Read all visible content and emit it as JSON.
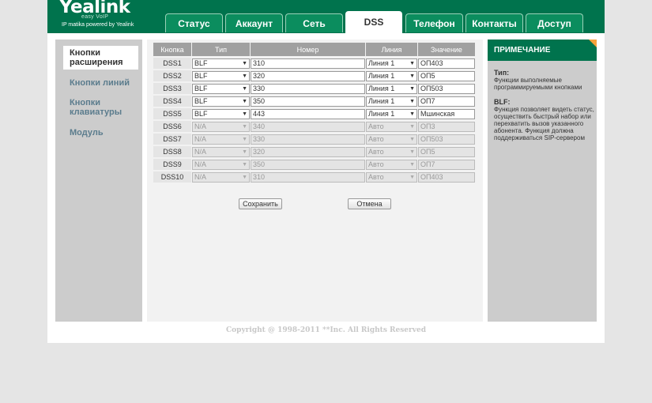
{
  "brand": {
    "logo": "Yealink",
    "sub": "easy VoIP",
    "tagline": "IP matika powered by Yealink"
  },
  "tabs": [
    "Статус",
    "Аккаунт",
    "Сеть",
    "DSS",
    "Телефон",
    "Контакты",
    "Доступ"
  ],
  "active_tab": "DSS",
  "sidebar": [
    "Кнопки расширения",
    "Кнопки линий",
    "Кнопки клавиатуры",
    "Модуль"
  ],
  "table": {
    "headers": [
      "Кнопка",
      "Тип",
      "Номер",
      "Линия",
      "Значение"
    ],
    "rows": [
      {
        "key": "DSS1",
        "type": "BLF",
        "number": "310",
        "line": "Линия 1",
        "value": "ОП403",
        "enabled": true
      },
      {
        "key": "DSS2",
        "type": "BLF",
        "number": "320",
        "line": "Линия 1",
        "value": "ОП5",
        "enabled": true
      },
      {
        "key": "DSS3",
        "type": "BLF",
        "number": "330",
        "line": "Линия 1",
        "value": "ОП503",
        "enabled": true
      },
      {
        "key": "DSS4",
        "type": "BLF",
        "number": "350",
        "line": "Линия 1",
        "value": "ОП7",
        "enabled": true
      },
      {
        "key": "DSS5",
        "type": "BLF",
        "number": "443",
        "line": "Линия 1",
        "value": "Мшинская",
        "enabled": true
      },
      {
        "key": "DSS6",
        "type": "N/A",
        "number": "340",
        "line": "Авто",
        "value": "ОП3",
        "enabled": false
      },
      {
        "key": "DSS7",
        "type": "N/A",
        "number": "330",
        "line": "Авто",
        "value": "ОП503",
        "enabled": false
      },
      {
        "key": "DSS8",
        "type": "N/A",
        "number": "320",
        "line": "Авто",
        "value": "ОП5",
        "enabled": false
      },
      {
        "key": "DSS9",
        "type": "N/A",
        "number": "350",
        "line": "Авто",
        "value": "ОП7",
        "enabled": false
      },
      {
        "key": "DSS10",
        "type": "N/A",
        "number": "310",
        "line": "Авто",
        "value": "ОП403",
        "enabled": false
      }
    ]
  },
  "buttons": {
    "save": "Сохранить",
    "cancel": "Отмена"
  },
  "note": {
    "title": "ПРИМЕЧАНИЕ",
    "type_label": "Тип:",
    "type_text": "Функции выполняемые программируемыми кнопками",
    "blf_label": "BLF:",
    "blf_text": "Функция позволяет видеть статус, осуществить быстрый набор или перехватить вызов указанного абонента. Функция должна поддерживаться SIP-сервером"
  },
  "footer": "Copyright @ 1998-2011 **Inc. All Rights Reserved",
  "colors": {
    "header": "#00734d",
    "tab": "#0b8d5e",
    "accent": "#f6a23c",
    "sidebar_link": "#5b7c8d"
  }
}
